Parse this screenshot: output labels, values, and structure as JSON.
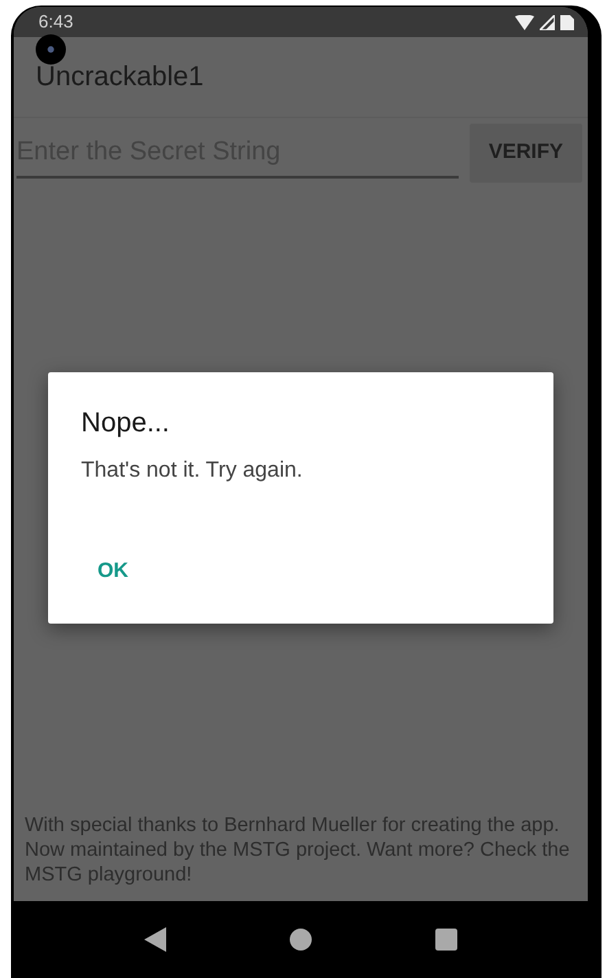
{
  "status_bar": {
    "time": "6:43"
  },
  "app_bar": {
    "title": "Uncrackable1"
  },
  "secret_field": {
    "placeholder": "Enter the Secret String"
  },
  "verify_button": {
    "label": "VERIFY"
  },
  "dialog": {
    "title": "Nope...",
    "message": "That's not it. Try again.",
    "buttons": [
      "OK"
    ]
  },
  "footer": {
    "text": "With special thanks to Bernhard Mueller for creating the app. Now maintained by the MSTG project. Want more? Check the MSTG playground!"
  }
}
